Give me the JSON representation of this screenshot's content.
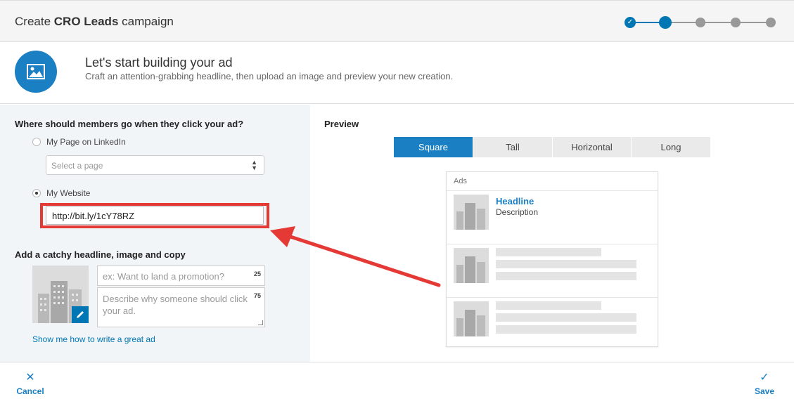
{
  "header": {
    "title_prefix": "Create",
    "title_bold": "CRO Leads",
    "title_suffix": "campaign",
    "steps": [
      "done",
      "current",
      "todo",
      "todo",
      "todo"
    ]
  },
  "intro": {
    "icon": "image-icon",
    "title": "Let's start building your ad",
    "subtitle": "Craft an attention-grabbing headline, then upload an image and preview your new creation."
  },
  "destination": {
    "question": "Where should members go when they click your ad?",
    "options": [
      {
        "label": "My Page on LinkedIn",
        "checked": false
      },
      {
        "label": "My Website",
        "checked": true
      }
    ],
    "select_placeholder": "Select a page",
    "url_value": "http://bit.ly/1cY78RZ"
  },
  "creative": {
    "heading": "Add a catchy headline, image and copy",
    "headline_placeholder": "ex: Want to land a promotion?",
    "headline_counter": "25",
    "description_placeholder": "Describe why someone should click your ad.",
    "description_counter": "75",
    "help_link": "Show me how to write a great ad"
  },
  "preview": {
    "label": "Preview",
    "tabs": [
      {
        "label": "Square",
        "active": true
      },
      {
        "label": "Tall",
        "active": false
      },
      {
        "label": "Horizontal",
        "active": false
      },
      {
        "label": "Long",
        "active": false
      }
    ],
    "ads_label": "Ads",
    "ad_headline": "Headline",
    "ad_description": "Description"
  },
  "footer": {
    "cancel_label": "Cancel",
    "save_label": "Save"
  },
  "colors": {
    "accent": "#0077b5",
    "highlight": "#e53935"
  }
}
